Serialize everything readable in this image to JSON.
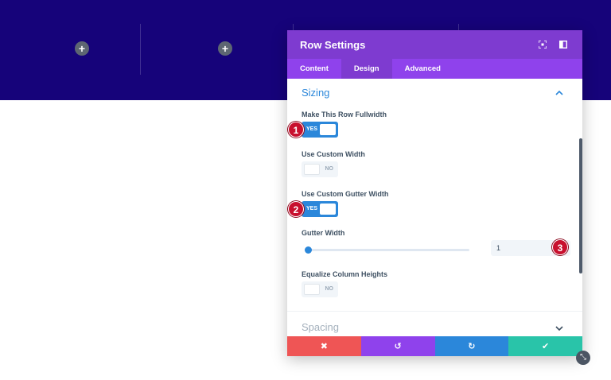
{
  "canvas": {
    "add_module_symbol": "+"
  },
  "modal": {
    "title": "Row Settings",
    "icons": [
      "expand-icon",
      "sidebar-toggle-icon"
    ],
    "tabs": [
      {
        "label": "Content",
        "active": false
      },
      {
        "label": "Design",
        "active": true
      },
      {
        "label": "Advanced",
        "active": false
      }
    ],
    "sections": {
      "sizing": {
        "title": "Sizing",
        "expanded": true,
        "fields": {
          "fullwidth": {
            "label": "Make This Row Fullwidth",
            "state": "YES"
          },
          "custom_width": {
            "label": "Use Custom Width",
            "state": "NO"
          },
          "custom_gutter": {
            "label": "Use Custom Gutter Width",
            "state": "YES"
          },
          "gutter_width": {
            "label": "Gutter Width",
            "value": "1",
            "slider_fraction": 0.0
          },
          "equalize": {
            "label": "Equalize Column Heights",
            "state": "NO"
          }
        }
      },
      "spacing": {
        "title": "Spacing",
        "expanded": false
      }
    },
    "footer": {
      "discard_symbol": "✖",
      "undo_symbol": "↺",
      "redo_symbol": "↻",
      "save_symbol": "✔"
    }
  },
  "markers": [
    "1",
    "2",
    "3"
  ],
  "colors": {
    "hero_bg": "#16037a",
    "header_bg": "#7e3bd0",
    "tabs_bg": "#8f42ec",
    "accent": "#2b87da",
    "discard": "#ef5555",
    "undo": "#8f42ec",
    "redo": "#2b87da",
    "save": "#29c4a9",
    "marker": "#c8102e"
  }
}
